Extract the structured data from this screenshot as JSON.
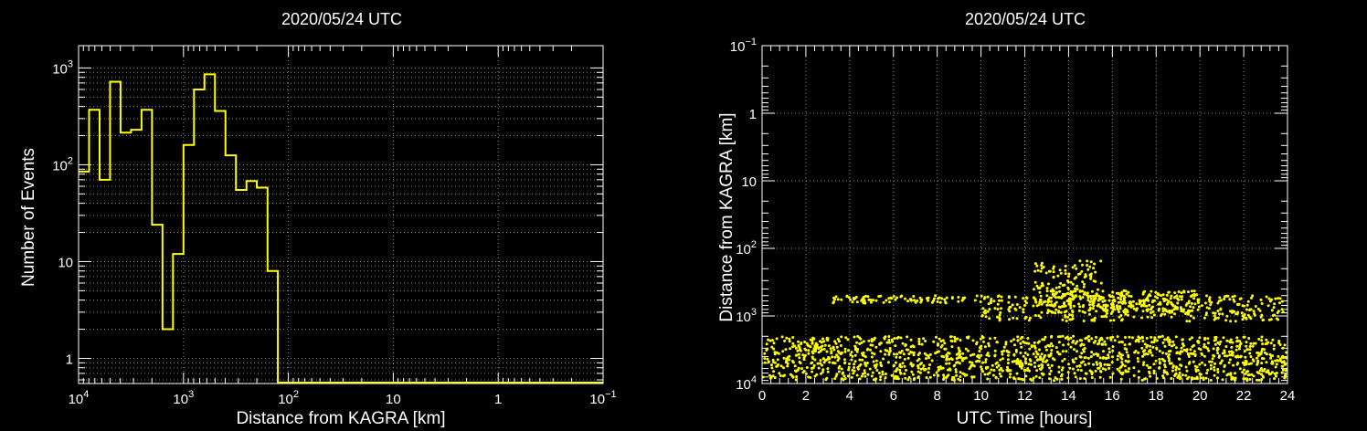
{
  "chart_data": [
    {
      "type": "histogram",
      "title": "2020/05/24 UTC",
      "xlabel": "Distance from KAGRA [km]",
      "ylabel": "Number of Events",
      "x_scale": "log-reversed",
      "y_scale": "log",
      "xlim": [
        10000,
        0.1
      ],
      "ylim": [
        0.55,
        1700
      ],
      "grid": true,
      "line_color": "#ffff00",
      "x_ticks": [
        {
          "base": "10",
          "exp": "4"
        },
        {
          "base": "10",
          "exp": "3"
        },
        {
          "base": "10",
          "exp": "2"
        },
        {
          "base": "10",
          "exp": ""
        },
        {
          "base": "1",
          "exp": ""
        },
        {
          "base": "10",
          "exp": "−1"
        }
      ],
      "y_ticks": [
        {
          "base": "10",
          "exp": "3"
        },
        {
          "base": "10",
          "exp": "2"
        },
        {
          "base": "10",
          "exp": ""
        },
        {
          "base": "1",
          "exp": ""
        }
      ],
      "bin_edges": [
        10000,
        7943,
        6310,
        5012,
        3981,
        3162,
        2512,
        1995,
        1585,
        1259,
        1000,
        794,
        631,
        501,
        398,
        316,
        251,
        200,
        158,
        126,
        100,
        0.1
      ],
      "values": [
        85,
        370,
        70,
        720,
        215,
        230,
        370,
        24,
        2,
        12,
        160,
        600,
        860,
        360,
        125,
        55,
        68,
        58,
        8,
        0,
        0
      ]
    },
    {
      "type": "scatter",
      "title": "2020/05/24 UTC",
      "xlabel": "UTC Time [hours]",
      "ylabel": "Distance from KAGRA [km]",
      "y_scale": "log-reversed",
      "xlim": [
        0,
        24
      ],
      "ylim": [
        10000,
        0.1
      ],
      "grid": true,
      "marker_color": "#ffff00",
      "x_ticks": [
        "0",
        "2",
        "4",
        "6",
        "8",
        "10",
        "12",
        "14",
        "16",
        "18",
        "20",
        "22",
        "24"
      ],
      "y_ticks": [
        {
          "base": "10",
          "exp": "−1"
        },
        {
          "base": "1",
          "exp": ""
        },
        {
          "base": "10",
          "exp": ""
        },
        {
          "base": "10",
          "exp": "2"
        },
        {
          "base": "10",
          "exp": "3"
        },
        {
          "base": "10",
          "exp": "4"
        }
      ],
      "bands": [
        {
          "t": [
            12.4,
            15.5
          ],
          "d": [
            150,
            700
          ],
          "n": 120
        },
        {
          "t": [
            13.0,
            20.0
          ],
          "d": [
            420,
            900
          ],
          "n": 260
        },
        {
          "t": [
            10.0,
            23.8
          ],
          "d": [
            500,
            1200
          ],
          "n": 320
        },
        {
          "t": [
            3.0,
            10.5
          ],
          "d": [
            500,
            650
          ],
          "n": 90
        },
        {
          "t": [
            0.0,
            24.0
          ],
          "d": [
            2000,
            9000
          ],
          "n": 1400
        }
      ]
    }
  ]
}
